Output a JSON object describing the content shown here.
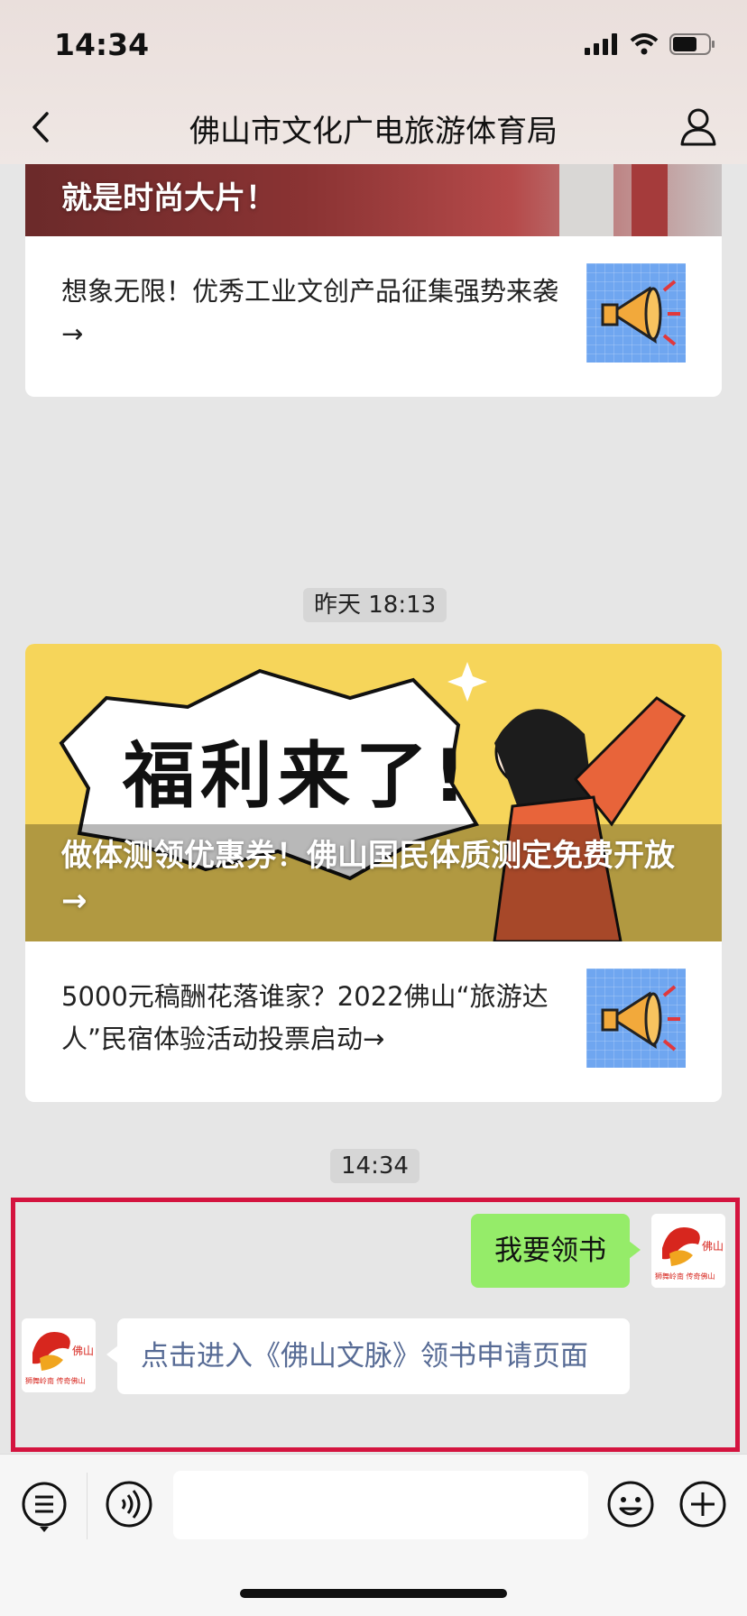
{
  "status_bar": {
    "time": "14:34"
  },
  "nav": {
    "title": "佛山市文化广电旅游体育局"
  },
  "messages": {
    "card1": {
      "hero_text": "就是时尚大片！",
      "item_text": "想象无限！优秀工业文创产品征集强势来袭→"
    },
    "time_chip_1": "昨天 18:13",
    "card2": {
      "hero_banner_text": "福利来了!",
      "hero_text": "做体测领优惠券！佛山国民体质测定免费开放→",
      "item_text": "5000元稿酬花落谁家？2022佛山“旅游达人”民宿体验活动投票启动→"
    },
    "time_chip_2": "14:34",
    "outgoing_text": "我要领书",
    "incoming_link_text": "点击进入《佛山文脉》领书申请页面",
    "avatar_caption": "狮舞岭南 传奇佛山"
  },
  "icons": {
    "back": "chevron-left-icon",
    "profile": "person-icon",
    "menu": "menu-list-icon",
    "voice": "voice-icon",
    "emoji": "emoji-icon",
    "plus": "plus-icon",
    "thumb": "megaphone-icon"
  },
  "colors": {
    "highlight_border": "#d4143f",
    "outgoing_bubble": "#95ec69",
    "link_text": "#576b95"
  }
}
